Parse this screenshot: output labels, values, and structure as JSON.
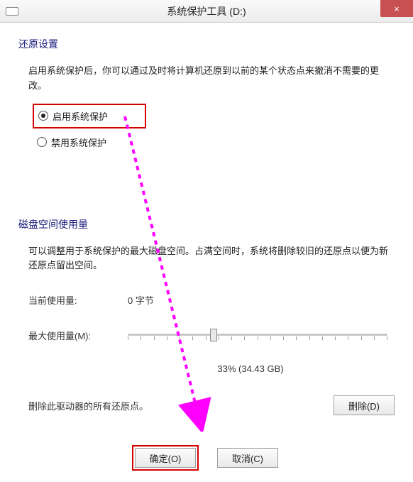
{
  "titlebar": {
    "title": "系统保护工具 (D:)",
    "close_glyph": "×"
  },
  "restore": {
    "section_title": "还原设置",
    "description": "启用系统保护后，你可以通过及时将计算机还原到以前的某个状态点来撤消不需要的更改。",
    "option_enable": "启用系统保护",
    "option_disable": "禁用系统保护"
  },
  "disk": {
    "section_title": "磁盘空间使用量",
    "description": "可以调整用于系统保护的最大磁盘空间。占满空间时，系统将删除较旧的还原点以便为新还原点留出空间。",
    "current_label": "当前使用量:",
    "current_value": "0 字节",
    "max_label": "最大使用量(M):",
    "slider_percent": 33,
    "slider_value_text": "33% (34.43 GB)",
    "delete_text": "删除此驱动器的所有还原点。",
    "delete_button": "删除(D)"
  },
  "footer": {
    "ok_button": "确定(O)",
    "cancel_button": "取消(C)"
  }
}
